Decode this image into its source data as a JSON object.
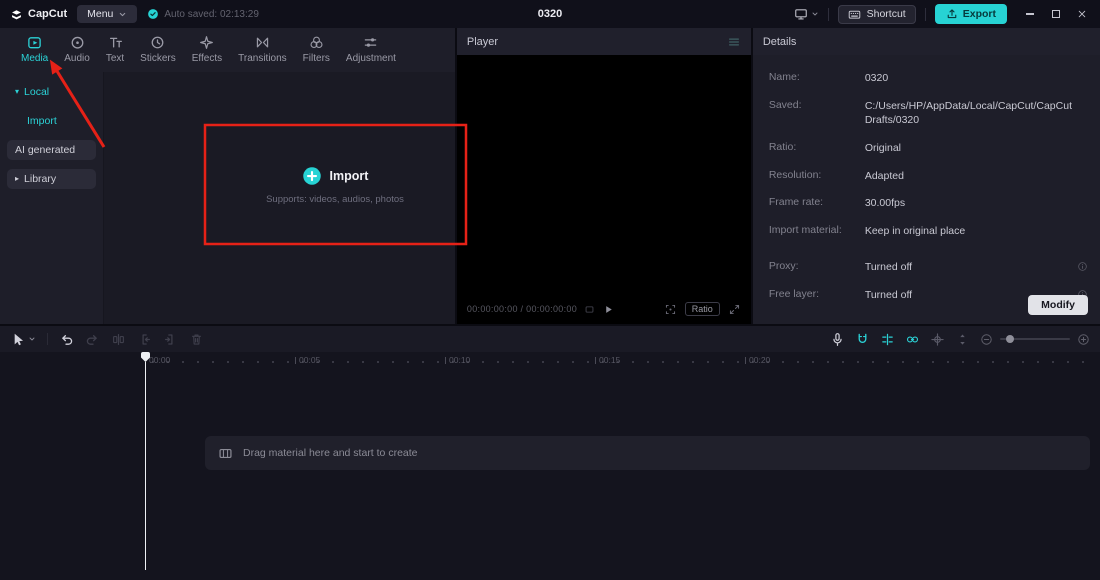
{
  "colors": {
    "accent": "#27d3d4",
    "annotation_red": "#e62117"
  },
  "titlebar": {
    "logo_text": "CapCut",
    "menu_label": "Menu",
    "autosave_text": "Auto saved: 02:13:29",
    "project_title": "0320",
    "shortcut_label": "Shortcut",
    "export_label": "Export"
  },
  "media_panel": {
    "tabs": [
      {
        "label": "Media",
        "icon": "media-icon",
        "active": true
      },
      {
        "label": "Audio",
        "icon": "audio-icon",
        "active": false
      },
      {
        "label": "Text",
        "icon": "text-icon",
        "active": false
      },
      {
        "label": "Stickers",
        "icon": "sticker-icon",
        "active": false
      },
      {
        "label": "Effects",
        "icon": "effects-icon",
        "active": false
      },
      {
        "label": "Transitions",
        "icon": "transitions-icon",
        "active": false
      },
      {
        "label": "Filters",
        "icon": "filters-icon",
        "active": false
      },
      {
        "label": "Adjustment",
        "icon": "adjustment-icon",
        "active": false
      }
    ],
    "sidebar": [
      {
        "label": "Local",
        "expanded": true,
        "active": true
      },
      {
        "label": "Import",
        "active": true
      },
      {
        "label": "AI generated",
        "active": false
      },
      {
        "label": "Library",
        "expanded": false,
        "active": false
      }
    ],
    "import_area": {
      "title": "Import",
      "subtitle": "Supports: videos, audios, photos"
    }
  },
  "player": {
    "title": "Player",
    "timecode": "00:00:00:00 / 00:00:00:00",
    "ratio_label": "Ratio"
  },
  "details": {
    "title": "Details",
    "fields": [
      {
        "label": "Name:",
        "value": "0320"
      },
      {
        "label": "Saved:",
        "value": "C:/Users/HP/AppData/Local/CapCut/CapCut Drafts/0320"
      },
      {
        "label": "Ratio:",
        "value": "Original"
      },
      {
        "label": "Resolution:",
        "value": "Adapted"
      },
      {
        "label": "Frame rate:",
        "value": "30.00fps"
      },
      {
        "label": "Import material:",
        "value": "Keep in original place"
      },
      {
        "label": "Proxy:",
        "value": "Turned off",
        "has_info": true
      },
      {
        "label": "Free layer:",
        "value": "Turned off",
        "has_info": true
      }
    ],
    "modify_label": "Modify"
  },
  "timeline": {
    "ruler_marks": [
      "00:00",
      "00:05",
      "00:10",
      "00:15",
      "00:20"
    ],
    "empty_hint": "Drag material here and start to create"
  }
}
